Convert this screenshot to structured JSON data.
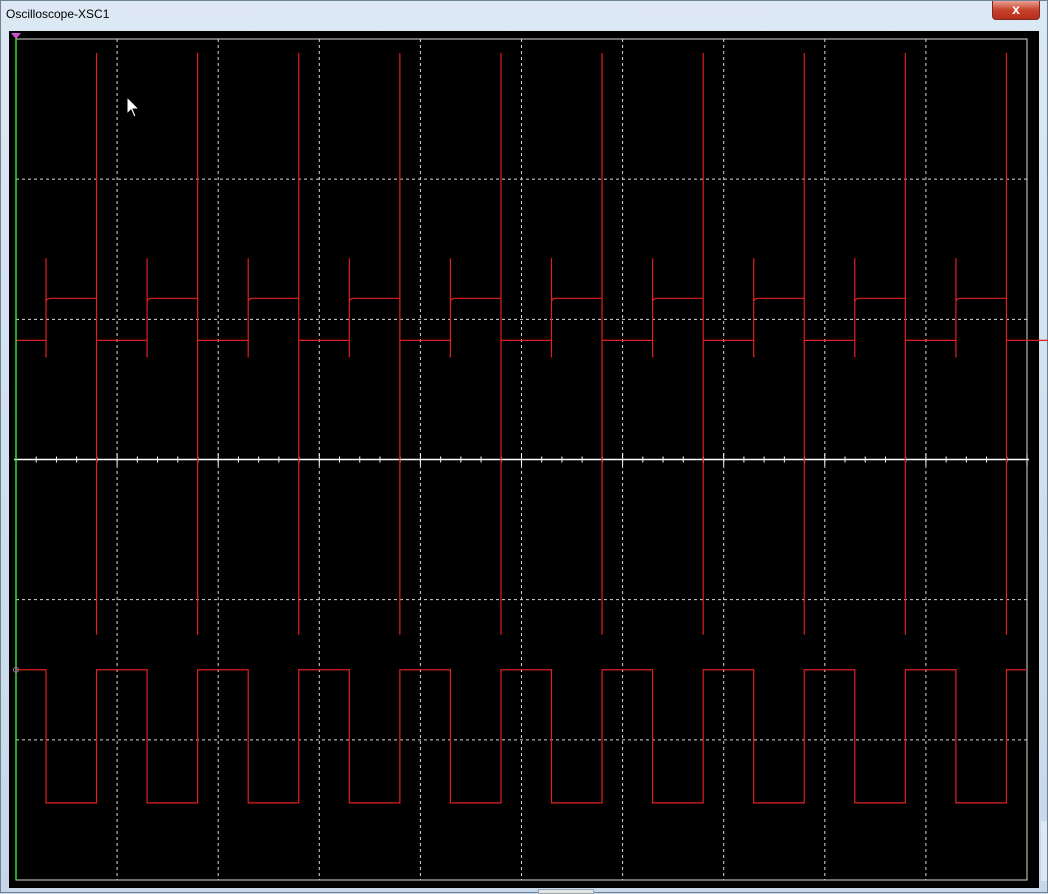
{
  "window": {
    "title": "Oscilloscope-XSC1",
    "close_label": "x"
  },
  "scope": {
    "background_color": "#000000",
    "grid_color": "#d8d8d8",
    "axis_color": "#ffffff",
    "trace_color": "#e02020",
    "cursor1_color": "#33dd33",
    "cursor_marker_color": "#cc55cc",
    "horizontal_divisions": 10,
    "vertical_divisions": 6,
    "minor_ticks_per_division": 5,
    "channel_a": {
      "description": "differentiated spikes with stepped square baseline",
      "pulse_count": 10,
      "high_level_div": 1.15,
      "low_level_div": 0.85,
      "spike_top_div": 2.9,
      "spike_bottom_div": -1.25
    },
    "channel_b": {
      "description": "square wave",
      "cycle_count": 10,
      "high_level_div": -1.5,
      "low_level_div": -2.45
    }
  }
}
